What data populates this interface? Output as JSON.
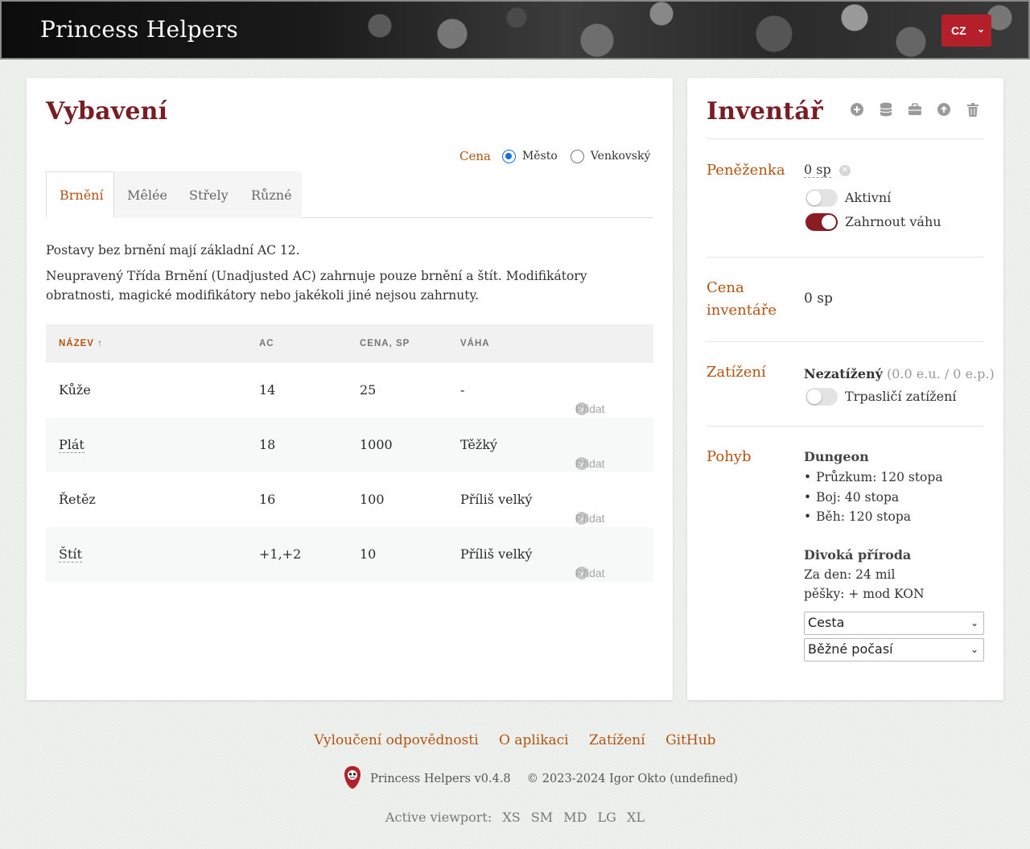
{
  "header": {
    "brand": "Princess Helpers",
    "lang": "CZ"
  },
  "equipment": {
    "title": "Vybavení",
    "price_label": "Cena",
    "price_options": [
      "Město",
      "Venkovský"
    ],
    "price_selected": "Město",
    "tabs": [
      "Brnění",
      "Mêlée",
      "Střely",
      "Různé"
    ],
    "active_tab": "Brnění",
    "intro1": "Postavy bez brnění mají základní AC 12.",
    "intro2": "Neupravený Třída Brnění (Unadjusted AC) zahrnuje pouze brnění a štít. Modifikátory obratnosti, magické modifikátory nebo jakékoli jiné nejsou zahrnuty.",
    "columns": [
      "NÁZEV ↑",
      "AC",
      "CENA, SP",
      "VÁHA"
    ],
    "add_label": "Přidat",
    "rows": [
      {
        "name": "Kůže",
        "ac": "14",
        "price": "25",
        "weight": "-"
      },
      {
        "name": "Plát",
        "ac": "18",
        "price": "1000",
        "weight": "Těžký"
      },
      {
        "name": "Řetěz",
        "ac": "16",
        "price": "100",
        "weight": "Příliš velký"
      },
      {
        "name": "Štít",
        "ac": "+1,+2",
        "price": "10",
        "weight": "Příliš velký"
      }
    ]
  },
  "inventory": {
    "title": "Inventář",
    "wallet": {
      "label": "Peněženka",
      "value": "0 sp",
      "active_label": "Aktivní",
      "active": false,
      "include_weight_label": "Zahrnout váhu",
      "include_weight": true
    },
    "inventory_price": {
      "label_line1": "Cena",
      "label_line2": "inventáře",
      "value": "0 sp"
    },
    "encumbrance": {
      "label": "Zatížení",
      "status": "Nezatížený",
      "detail": "(0.0 e.u. / 0 e.p.)",
      "dwarf_label": "Trpasličí zatížení",
      "dwarf": false
    },
    "movement": {
      "label": "Pohyb",
      "dungeon_title": "Dungeon",
      "dungeon_items": [
        "Průzkum: 120 stopa",
        "Boj: 40 stopa",
        "Běh: 120 stopa"
      ],
      "wild_title": "Divoká příroda",
      "wild_line1": "Za den: 24 mil",
      "wild_line2": "pěšky: + mod KON",
      "terrain": "Cesta",
      "weather": "Běžné počasí"
    }
  },
  "footer": {
    "links": [
      "Vyloučení odpovědnosti",
      "O aplikaci",
      "Zatížení",
      "GitHub"
    ],
    "version": "Princess Helpers v0.4.8",
    "copyright": "© 2023-2024 Igor Okto (undefined)",
    "viewport_label": "Active viewport:",
    "breakpoints": [
      "XS",
      "SM",
      "MD",
      "LG",
      "XL"
    ]
  },
  "colors": {
    "accent": "#b3530f",
    "title": "#7a1d22",
    "brand_red": "#b4202a"
  }
}
